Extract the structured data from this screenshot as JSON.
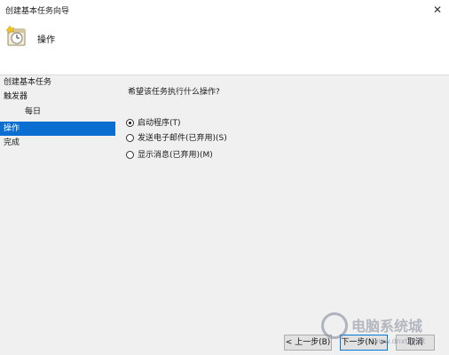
{
  "window": {
    "title": "创建基本任务向导",
    "close_glyph": "✕"
  },
  "header": {
    "title": "操作",
    "icon": "task-clock-icon"
  },
  "sidebar": {
    "items": [
      {
        "label": "创建基本任务",
        "selected": false,
        "sub": false
      },
      {
        "label": "触发器",
        "selected": false,
        "sub": false
      },
      {
        "label": "每日",
        "selected": false,
        "sub": true
      },
      {
        "label": "操作",
        "selected": true,
        "sub": false
      },
      {
        "label": "完成",
        "selected": false,
        "sub": false
      }
    ]
  },
  "main": {
    "question": "希望该任务执行什么操作?",
    "options": [
      {
        "label": "启动程序(T)",
        "checked": true
      },
      {
        "label": "发送电子邮件(已弃用)(S)",
        "checked": false
      },
      {
        "label": "显示消息(已弃用)(M)",
        "checked": false
      }
    ]
  },
  "footer": {
    "back_label": "< 上一步(B)",
    "next_label": "下一步(N) >",
    "cancel_label": "取消"
  },
  "watermark": {
    "brand": "电脑系统城",
    "url": "www.dnxtc.net"
  },
  "colors": {
    "selection": "#0a6fd1",
    "primary_border": "#0078d7",
    "panel_bg": "#f0f0f0"
  }
}
